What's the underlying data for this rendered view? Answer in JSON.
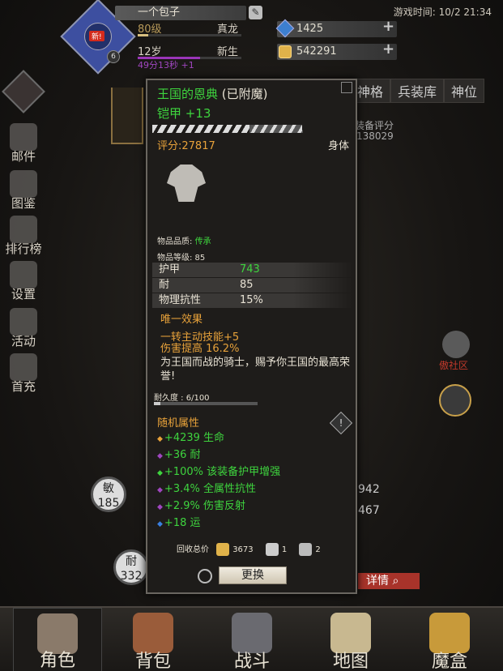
{
  "header": {
    "time": "游戏时间: 10/2 21:34",
    "player_name": "一个包子",
    "level": "80级",
    "title1": "真龙",
    "age": "12岁",
    "title2": "新生",
    "timer": "49分13秒 +1",
    "new_badge": "新!",
    "small_level": "6",
    "gems": "1425",
    "gold": "542291"
  },
  "side_menu": [
    "邮件",
    "图鉴",
    "排行榜",
    "设置",
    "活动",
    "首充"
  ],
  "bg_tabs": [
    "神格",
    "兵装库",
    "神位"
  ],
  "bg_score_label": "装备评分",
  "bg_score_value": "138029",
  "bg_stats": {
    "agility": "敏",
    "agility_value": "185",
    "endurance": "耐",
    "endurance_value": "332",
    "right1": "942",
    "right2": "467"
  },
  "guild_label": "傲社区",
  "detail_button": "详情",
  "nav": [
    "角色",
    "背包",
    "战斗",
    "地图",
    "魔盒"
  ],
  "tooltip": {
    "name": "王国的恩典",
    "enchant": "(已附魔)",
    "sub": "铠甲 +13",
    "score": "评分:27817",
    "slot": "身体",
    "quality_label": "物品品质:",
    "quality": "传承",
    "item_level": "物品等级: 85",
    "stats": [
      {
        "k": "护甲",
        "v": "743"
      },
      {
        "k": "耐",
        "v": "85"
      },
      {
        "k": "物理抗性",
        "v": "15%"
      }
    ],
    "unique_title": "唯一效果",
    "unique_1": "一转主动技能+5",
    "unique_2": "伤害提高 16.2%",
    "desc": "为王国而战的骑士，赐予你王国的最高荣誉!",
    "durability": "耐久度 : 6/100",
    "random_title": "随机属性",
    "random": [
      {
        "text": "+4239 生命",
        "color": "#e8a23a"
      },
      {
        "text": "+36 耐",
        "color": "#a046c0"
      },
      {
        "text": "+100% 该装备护甲增强",
        "color": "#3ed43e"
      },
      {
        "text": "+3.4% 全属性抗性",
        "color": "#a046c0"
      },
      {
        "text": "+2.9% 伤害反射",
        "color": "#a046c0"
      },
      {
        "text": "+18 运",
        "color": "#3a7fe0"
      }
    ],
    "recycle_label": "回收总价",
    "recycle_gold": "3673",
    "recycle_a": "1",
    "recycle_b": "2",
    "replace_button": "更换"
  }
}
